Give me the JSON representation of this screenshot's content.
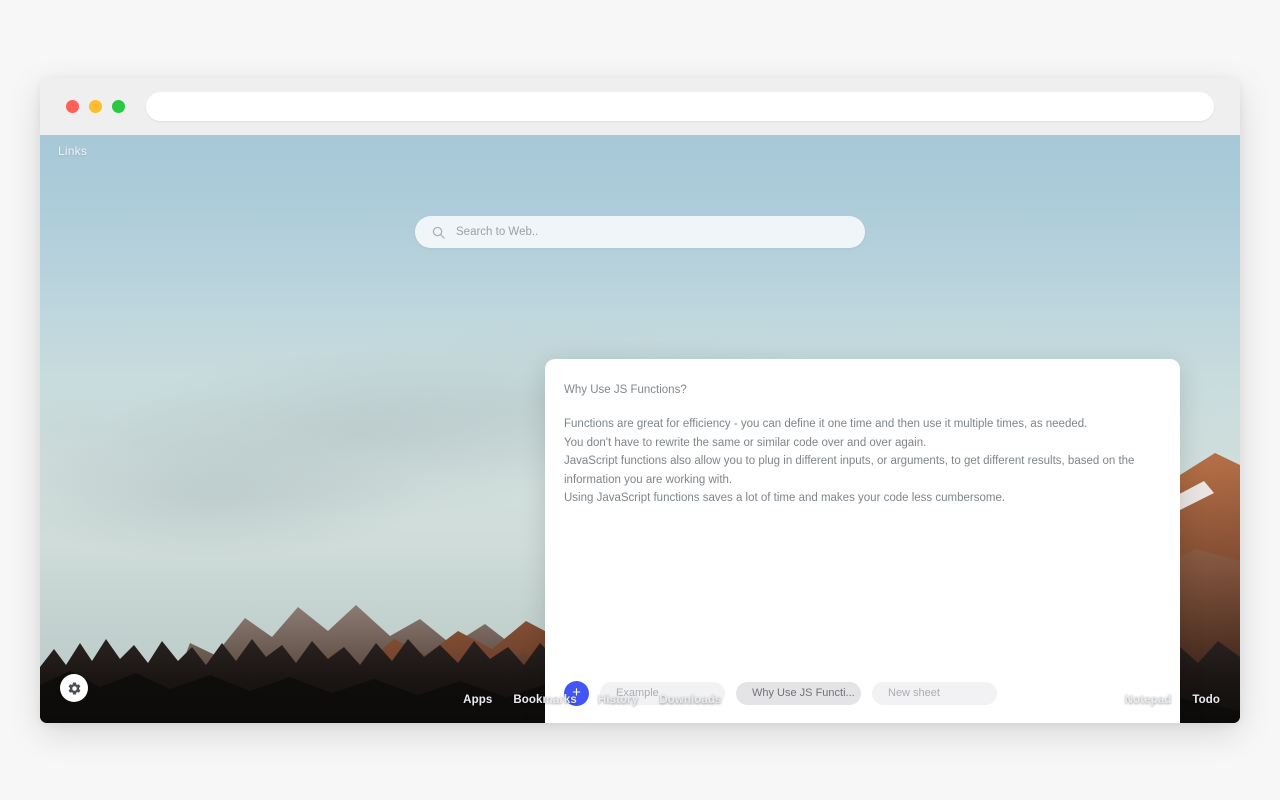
{
  "window": {
    "traffic_lights": [
      {
        "name": "close",
        "color": "#ff5f57"
      },
      {
        "name": "minimize",
        "color": "#febc2e"
      },
      {
        "name": "maximize",
        "color": "#28c840"
      }
    ],
    "address_bar": {
      "value": "",
      "placeholder": ""
    }
  },
  "page": {
    "links_label": "Links",
    "search": {
      "value": "",
      "placeholder": "Search to Web..",
      "icon": "search-icon"
    },
    "settings": {
      "icon": "gear-icon",
      "label": "Settings"
    }
  },
  "notepad": {
    "title": "Why Use JS Functions?",
    "text": "Functions are great for efficiency - you can define it one time and then use it multiple times, as needed.\nYou don't have to rewrite the same or similar code over and over again.\nJavaScript functions also allow you to plug in different inputs, or arguments, to get different results, based on the information you are working with.\nUsing JavaScript functions saves a lot of time and makes your code less cumbersome.",
    "add_button_label": "+",
    "accent_color": "#4355f5",
    "tabs": [
      {
        "label": "Example",
        "active": false
      },
      {
        "label": "Why Use JS Functi...",
        "active": true
      },
      {
        "label": "New sheet",
        "active": false
      }
    ]
  },
  "taskbar": {
    "left_links": [
      "Apps",
      "Bookmarks",
      "History",
      "Downloads"
    ],
    "right_links": [
      "Notepad",
      "Todo"
    ]
  }
}
